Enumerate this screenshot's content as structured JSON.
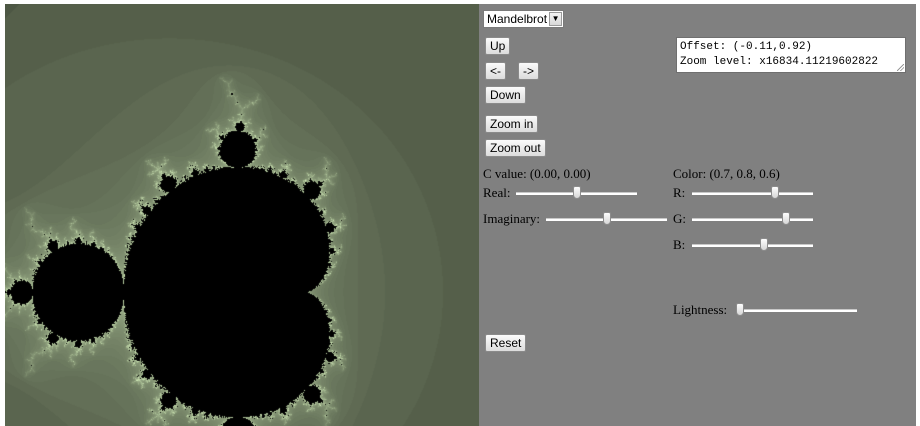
{
  "fractal_type": {
    "selected": "Mandelbrot"
  },
  "buttons": {
    "up": "Up",
    "left": "<-",
    "right": "->",
    "down": "Down",
    "zoom_in": "Zoom in",
    "zoom_out": "Zoom out",
    "reset": "Reset"
  },
  "info": {
    "offset_line": "Offset: (-0.11,0.92)",
    "zoom_line": "Zoom level: x16834.11219602822"
  },
  "c_value": {
    "label": "C value: (0.00, 0.00)",
    "real_label": "Real:",
    "imaginary_label": "Imaginary:",
    "real_level": 0.5,
    "imaginary_level": 0.5
  },
  "color": {
    "label": "Color: (0.7, 0.8, 0.6)",
    "r_label": "R:",
    "g_label": "G:",
    "b_label": "B:",
    "r_level": 0.7,
    "g_level": 0.8,
    "b_level": 0.6
  },
  "lightness": {
    "label": "Lightness:",
    "level": 0.0
  },
  "colors": {
    "panel_bg": "#808080",
    "fractal_bg": "#6c7a5e",
    "fractal_set": "#000000"
  }
}
